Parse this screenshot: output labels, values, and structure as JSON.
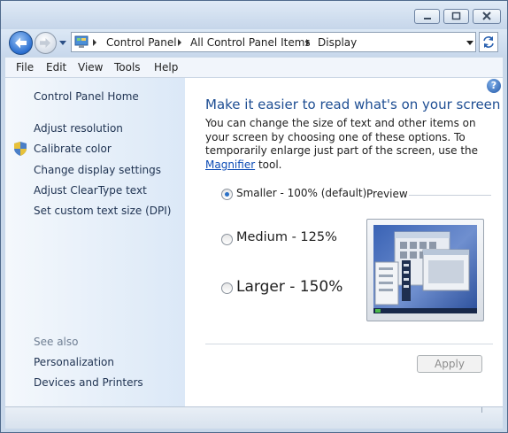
{
  "window": {
    "minimize_icon": "minimize-icon",
    "maximize_icon": "maximize-icon",
    "close_icon": "close-icon"
  },
  "address_bar": {
    "breadcrumbs": [
      "Control Panel",
      "All Control Panel Items",
      "Display"
    ],
    "folder_icon": "control-panel-icon",
    "refresh_icon": "refresh-icon"
  },
  "menu": [
    "File",
    "Edit",
    "View",
    "Tools",
    "Help"
  ],
  "sidebar": {
    "home": "Control Panel Home",
    "tasks": [
      "Adjust resolution",
      "Calibrate color",
      "Change display settings",
      "Adjust ClearType text",
      "Set custom text size (DPI)"
    ],
    "see_also_label": "See also",
    "see_also": [
      "Personalization",
      "Devices and Printers"
    ]
  },
  "main": {
    "heading": "Make it easier to read what's on your screen",
    "description_before": "You can change the size of text and other items on your screen by choosing one of these options. To temporarily enlarge just part of the screen, use the ",
    "magnifier_link": "Magnifier",
    "description_after": " tool.",
    "options": [
      {
        "label": "Smaller - 100% (default)",
        "selected": true
      },
      {
        "label": "Medium - 125%",
        "selected": false
      },
      {
        "label": "Larger - 150%",
        "selected": false
      }
    ],
    "preview_label": "Preview",
    "apply_label": "Apply",
    "help_icon": "help-icon"
  },
  "colors": {
    "heading": "#1e4e93",
    "link": "#0b4bb5",
    "sidebar_bg": "#dbe8f7"
  }
}
